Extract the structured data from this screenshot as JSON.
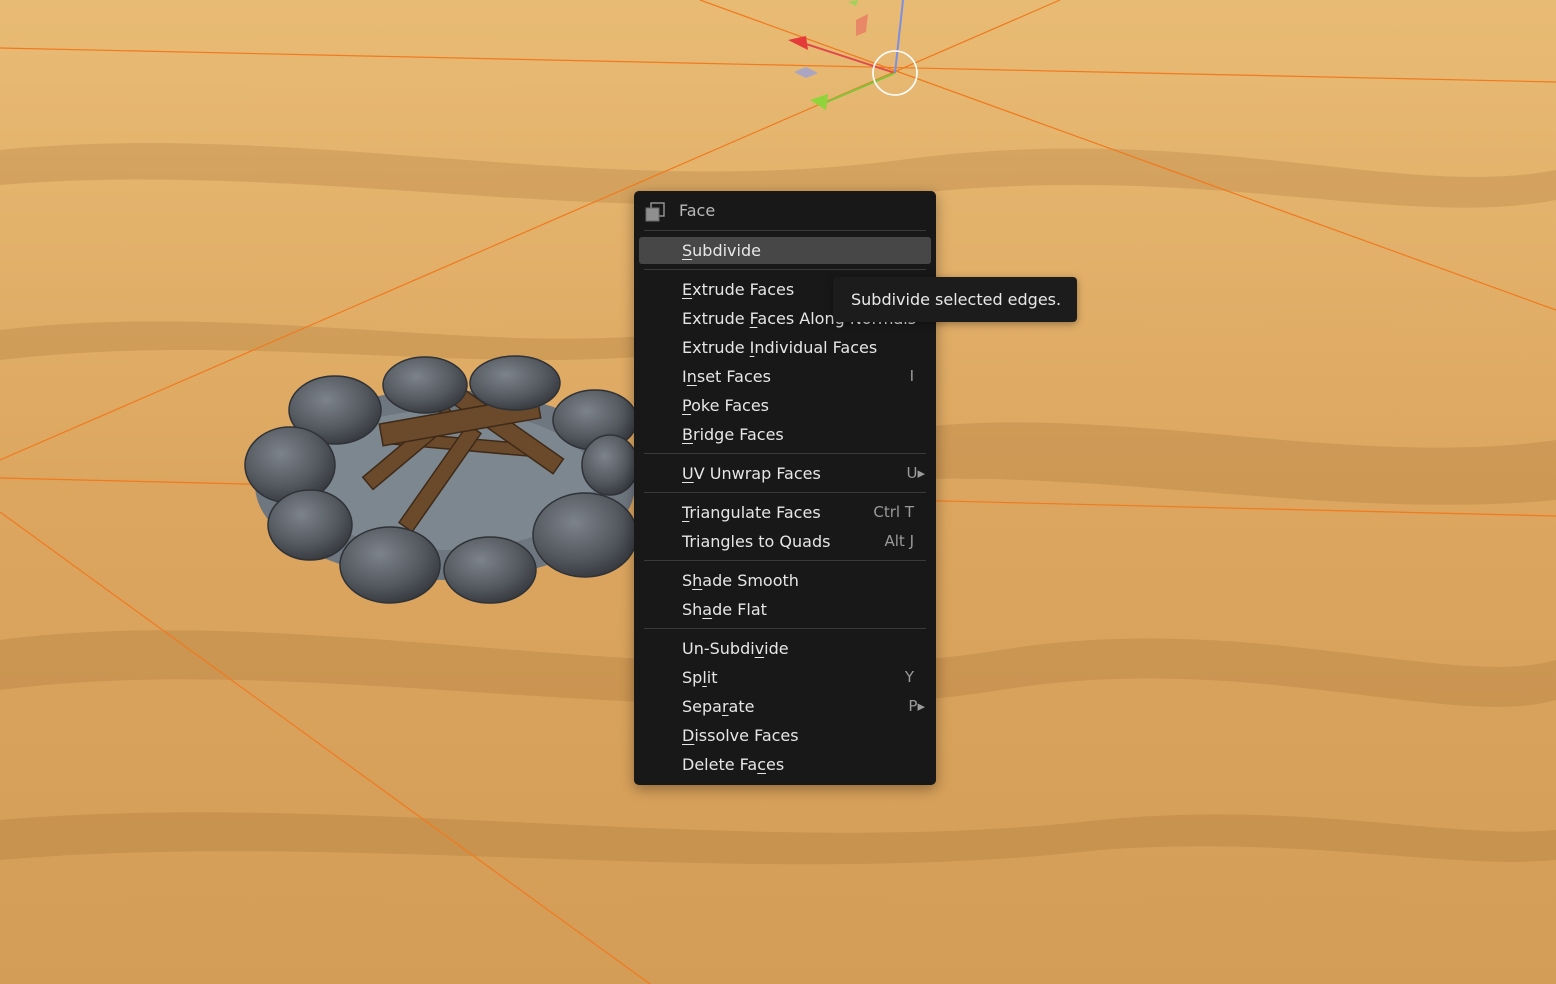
{
  "menu": {
    "title": "Face",
    "icon": "face-select-icon",
    "items": [
      {
        "pre": "",
        "ul": "S",
        "post": "ubdivide",
        "shortcut": ""
      },
      {
        "pre": "",
        "ul": "E",
        "post": "xtrude Faces",
        "shortcut": ""
      },
      {
        "pre": "Extrude ",
        "ul": "F",
        "post": "aces Along Normals",
        "shortcut": ""
      },
      {
        "pre": "Extrude ",
        "ul": "I",
        "post": "ndividual Faces",
        "shortcut": ""
      },
      {
        "pre": "I",
        "ul": "n",
        "post": "set Faces",
        "shortcut": "I"
      },
      {
        "pre": "",
        "ul": "P",
        "post": "oke Faces",
        "shortcut": ""
      },
      {
        "pre": "",
        "ul": "B",
        "post": "ridge Faces",
        "shortcut": ""
      },
      {
        "pre": "",
        "ul": "U",
        "post": "V Unwrap Faces",
        "shortcut": "U▸"
      },
      {
        "pre": "",
        "ul": "T",
        "post": "riangulate Faces",
        "shortcut": "Ctrl T"
      },
      {
        "pre": "Triangles to Quads",
        "ul": "",
        "post": "",
        "shortcut": "Alt J"
      },
      {
        "pre": "S",
        "ul": "h",
        "post": "ade Smooth",
        "shortcut": ""
      },
      {
        "pre": "Sh",
        "ul": "a",
        "post": "de Flat",
        "shortcut": ""
      },
      {
        "pre": "Un-Subdi",
        "ul": "v",
        "post": "ide",
        "shortcut": ""
      },
      {
        "pre": "Sp",
        "ul": "l",
        "post": "it",
        "shortcut": "Y"
      },
      {
        "pre": "Sepa",
        "ul": "r",
        "post": "ate",
        "shortcut": "P▸"
      },
      {
        "pre": "",
        "ul": "D",
        "post": "issolve Faces",
        "shortcut": ""
      },
      {
        "pre": "Delete Fa",
        "ul": "c",
        "post": "es",
        "shortcut": ""
      }
    ]
  },
  "tooltip": {
    "text": "Subdivide selected edges."
  },
  "colors": {
    "sand": "#d9a45e",
    "grid_line": "#f07a1e",
    "menu_bg": "#181818",
    "highlight": "#474747"
  }
}
